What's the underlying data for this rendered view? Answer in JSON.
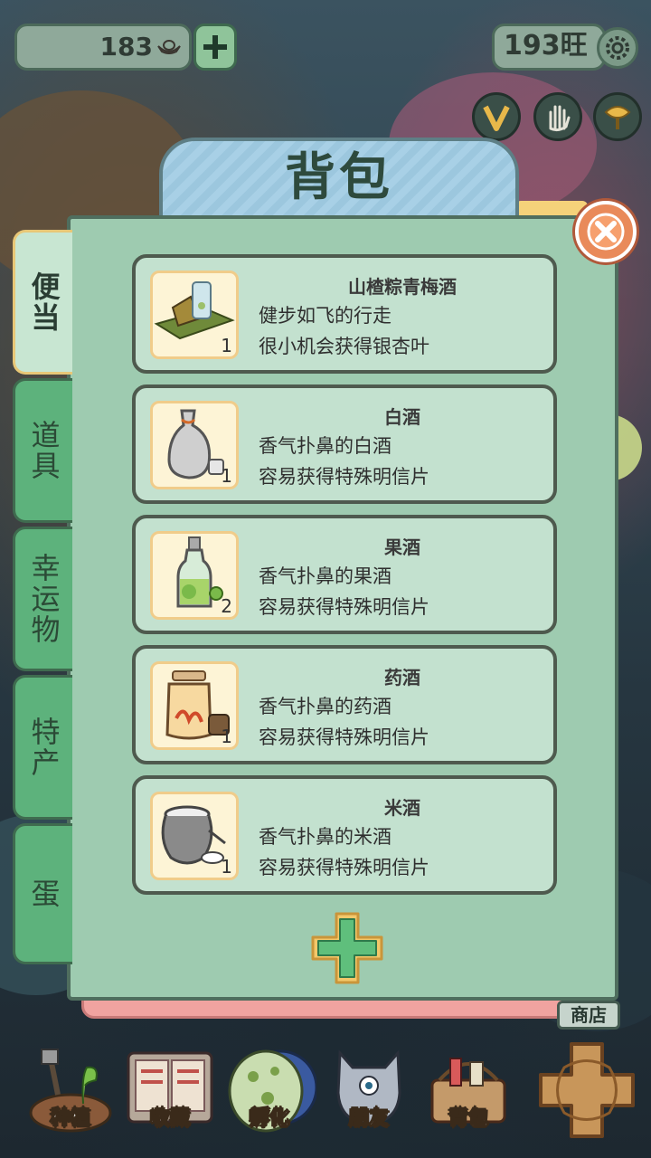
{
  "topbar": {
    "coins": "183",
    "wang": "193旺"
  },
  "panel": {
    "title": "背包"
  },
  "side_tabs": [
    {
      "label": "便当",
      "active": true
    },
    {
      "label": "道具",
      "active": false
    },
    {
      "label": "幸运物",
      "active": false
    },
    {
      "label": "特产",
      "active": false
    },
    {
      "label": "蛋",
      "active": false
    }
  ],
  "items": [
    {
      "name": "山楂粽青梅酒",
      "desc1": "健步如飞的行走",
      "desc2": "很小机会获得银杏叶",
      "count": "1",
      "icon": "zongzi-plum-wine-icon"
    },
    {
      "name": "白酒",
      "desc1": "香气扑鼻的白酒",
      "desc2": "容易获得特殊明信片",
      "count": "1",
      "icon": "white-liquor-jug-icon"
    },
    {
      "name": "果酒",
      "desc1": "香气扑鼻的果酒",
      "desc2": "容易获得特殊明信片",
      "count": "2",
      "icon": "fruit-wine-bottle-icon"
    },
    {
      "name": "药酒",
      "desc1": "香气扑鼻的药酒",
      "desc2": "容易获得特殊明信片",
      "count": "1",
      "icon": "herbal-wine-jar-icon"
    },
    {
      "name": "米酒",
      "desc1": "香气扑鼻的米酒",
      "desc2": "容易获得特殊明信片",
      "count": "1",
      "icon": "rice-wine-pot-icon"
    }
  ],
  "shop_label": "商店",
  "bottom_nav": [
    {
      "label": "种植",
      "icon": "plant-icon"
    },
    {
      "label": "收藏",
      "icon": "collection-book-icon"
    },
    {
      "label": "孵化",
      "icon": "egg-icon"
    },
    {
      "label": "朋友",
      "icon": "cat-friend-icon"
    },
    {
      "label": "背包",
      "icon": "basket-icon"
    }
  ],
  "colors": {
    "panel": "#9ecbb0",
    "card": "#c3e1cf",
    "accent_close": "#e98a5a",
    "tab_active": "#c8e6d2",
    "tab_inactive": "#5db27c"
  }
}
